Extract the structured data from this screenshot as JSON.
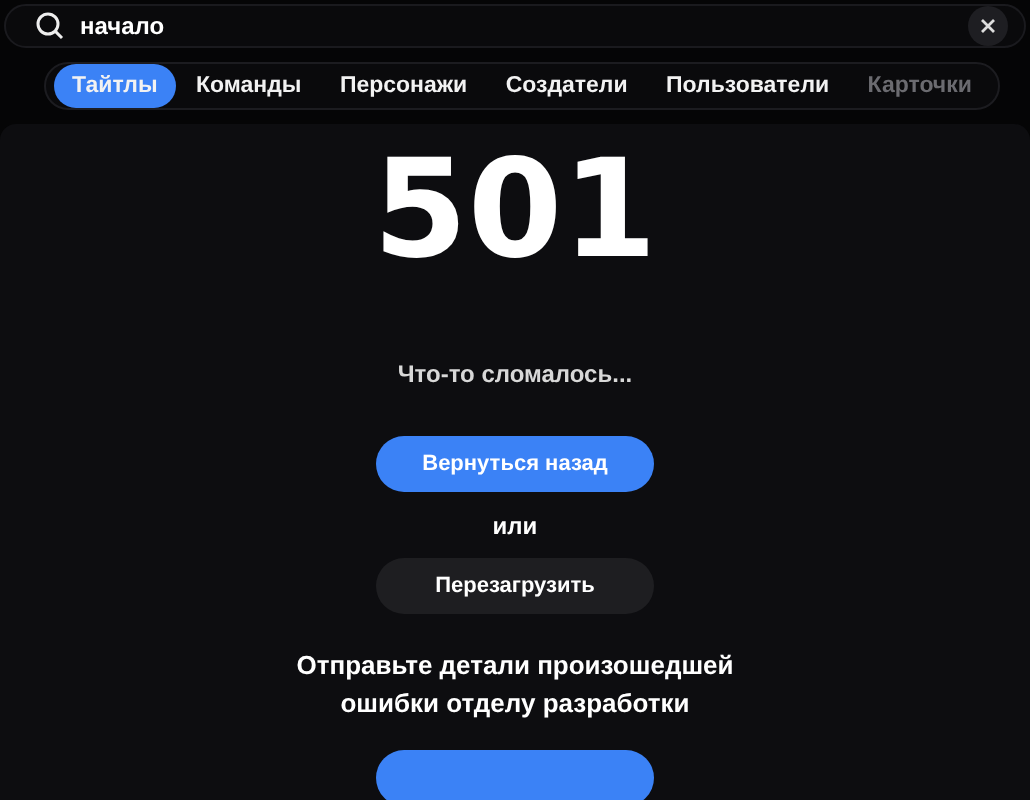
{
  "search": {
    "value": "начало"
  },
  "tabs": [
    {
      "label": "Тайтлы",
      "selected": true,
      "disabled": false
    },
    {
      "label": "Команды",
      "selected": false,
      "disabled": false
    },
    {
      "label": "Персонажи",
      "selected": false,
      "disabled": false
    },
    {
      "label": "Создатели",
      "selected": false,
      "disabled": false
    },
    {
      "label": "Пользователи",
      "selected": false,
      "disabled": false
    },
    {
      "label": "Карточки",
      "selected": false,
      "disabled": true
    }
  ],
  "error": {
    "code": "501",
    "message": "Что-то сломалось...",
    "separator": "или",
    "details": "Отправьте детали произошедшей ошибки отделу разработки"
  },
  "buttons": [
    {
      "label": "Вернуться назад",
      "kind": "primary"
    },
    {
      "label": "Перезагрузить",
      "kind": "secondary"
    },
    {
      "kind": "primary"
    }
  ]
}
